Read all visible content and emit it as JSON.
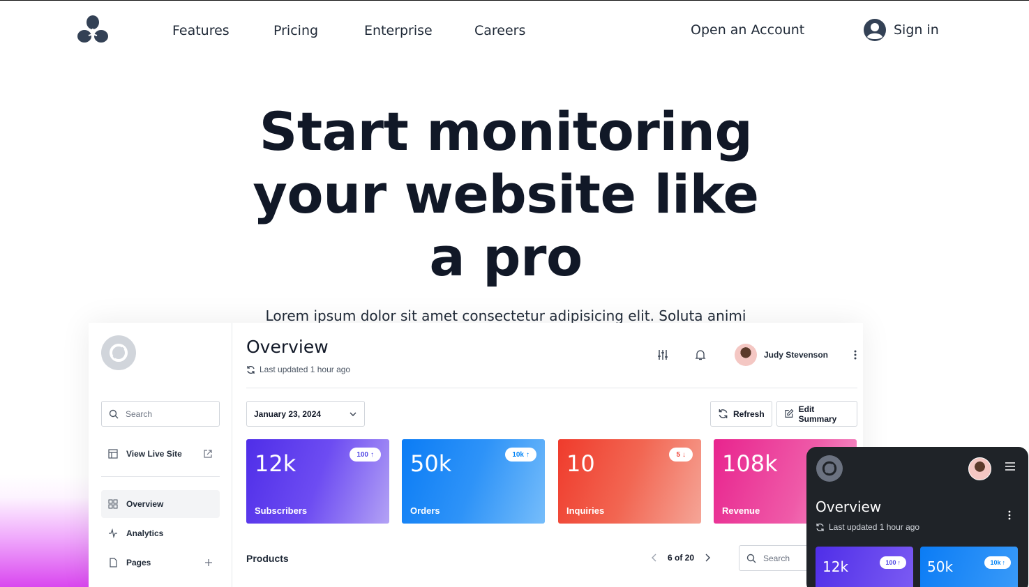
{
  "nav": {
    "links": [
      "Features",
      "Pricing",
      "Enterprise",
      "Careers"
    ],
    "open_account": "Open an Account",
    "sign_in": "Sign in"
  },
  "hero": {
    "title": "Start monitoring your website like a pro",
    "subtitle": "Lorem ipsum dolor sit amet consectetur adipisicing elit. Soluta animi"
  },
  "colors": {
    "text": "#1f2937",
    "accent_purple": "#4f46e5",
    "accent_blue": "#0284f7",
    "accent_red": "#f04438",
    "accent_pink": "#ec4899",
    "mobile_bg": "#1f2328"
  },
  "dashboard": {
    "sidebar": {
      "search_placeholder": "Search",
      "view_live_site": "View Live Site",
      "items": [
        "Overview",
        "Analytics",
        "Pages"
      ]
    },
    "title": "Overview",
    "last_updated": "Last updated 1 hour ago",
    "user_name": "Judy Stevenson",
    "date": "January 23, 2024",
    "refresh_label": "Refresh",
    "edit_summary_label": "Edit Summary",
    "cards": [
      {
        "value": "12k",
        "label": "Subscribers",
        "badge": "100",
        "trend": "up"
      },
      {
        "value": "50k",
        "label": "Orders",
        "badge": "10k",
        "trend": "up"
      },
      {
        "value": "10",
        "label": "Inquiries",
        "badge": "5",
        "trend": "down"
      },
      {
        "value": "108k",
        "label": "Revenue",
        "badge": "",
        "trend": ""
      }
    ],
    "products_label": "Products",
    "pager_text": "6 of 20",
    "products_search_placeholder": "Search"
  },
  "mobile": {
    "title": "Overview",
    "last_updated": "Last updated 1 hour ago",
    "cards": [
      {
        "value": "12k",
        "badge": "100"
      },
      {
        "value": "50k",
        "badge": "10k"
      }
    ]
  }
}
